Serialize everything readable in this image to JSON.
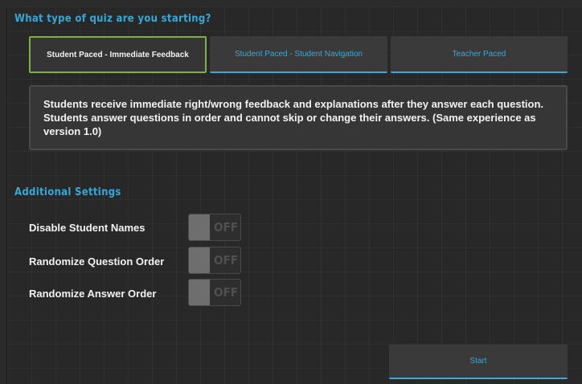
{
  "quiz_type": {
    "heading": "What type of quiz are you starting?",
    "tabs": [
      {
        "label": "Student Paced - Immediate Feedback",
        "active": true
      },
      {
        "label": "Student Paced - Student Navigation",
        "active": false
      },
      {
        "label": "Teacher Paced",
        "active": false
      }
    ],
    "description": "Students receive immediate right/wrong feedback and explanations after they answer each question. Students answer questions in order and cannot skip or change their answers. (Same experience as version 1.0)"
  },
  "settings": {
    "heading": "Additional Settings",
    "items": [
      {
        "label": "Disable Student Names",
        "state": "OFF"
      },
      {
        "label": "Randomize Question Order",
        "state": "OFF"
      },
      {
        "label": "Randomize Answer Order",
        "state": "OFF"
      }
    ]
  },
  "actions": {
    "start_label": "Start"
  },
  "colors": {
    "accent": "#34a8d6",
    "active_border": "#7fb239",
    "background": "#282828"
  }
}
